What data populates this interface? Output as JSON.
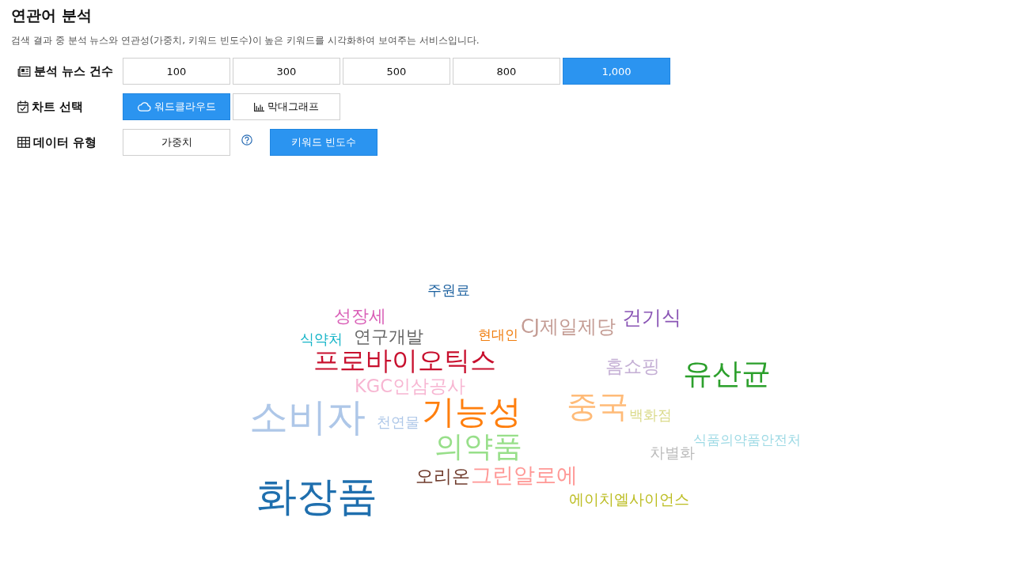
{
  "title": "연관어 분석",
  "description": "검색 결과 중 분석 뉴스와 연관성(가중치, 키워드 빈도수)이 높은 키워드를 시각화하여 보여주는 서비스입니다.",
  "options": [
    {
      "label": "분석 뉴스 건수",
      "choices": [
        {
          "label": "100",
          "selected": false,
          "help": false
        },
        {
          "label": "300",
          "selected": false,
          "help": false
        },
        {
          "label": "500",
          "selected": false,
          "help": false
        },
        {
          "label": "800",
          "selected": false,
          "help": false
        },
        {
          "label": "1,000",
          "selected": true,
          "help": false
        }
      ]
    },
    {
      "label": "차트 선택",
      "choices": [
        {
          "label": "워드클라우드",
          "selected": true,
          "help": false
        },
        {
          "label": "막대그래프",
          "selected": false,
          "help": false
        }
      ]
    },
    {
      "label": "데이터 유형",
      "choices": [
        {
          "label": "가중치",
          "selected": false,
          "help": true
        },
        {
          "label": "키워드 빈도수",
          "selected": true,
          "help": false
        }
      ]
    }
  ],
  "word_cloud": {
    "words": [
      {
        "text": "주원료",
        "color": "#1a5f9e"
      },
      {
        "text": "성장세",
        "color": "#d95fb7"
      },
      {
        "text": "식약처",
        "color": "#17b5c8"
      },
      {
        "text": "연구개발",
        "color": "#666666"
      },
      {
        "text": "현대인",
        "color": "#f07d0e"
      },
      {
        "text": "CJ제일제당",
        "color": "#c49c94"
      },
      {
        "text": "건기식",
        "color": "#8a55b5"
      },
      {
        "text": "프로바이오틱스",
        "color": "#c8102e"
      },
      {
        "text": "홈쇼핑",
        "color": "#c5b0d5"
      },
      {
        "text": "KGC인삼공사",
        "color": "#f7b6d2"
      },
      {
        "text": "유산균",
        "color": "#2ca02c"
      },
      {
        "text": "소비자",
        "color": "#aec7e8"
      },
      {
        "text": "천연물",
        "color": "#aec7e8"
      },
      {
        "text": "기능성",
        "color": "#ff7f0e"
      },
      {
        "text": "중국",
        "color": "#ffbb78"
      },
      {
        "text": "백화점",
        "color": "#dbdb8d"
      },
      {
        "text": "의약품",
        "color": "#98df8a"
      },
      {
        "text": "차별화",
        "color": "#bdbdbd"
      },
      {
        "text": "식품의약품안전처",
        "color": "#9edae5"
      },
      {
        "text": "오리온",
        "color": "#6f3b2c"
      },
      {
        "text": "그린알로에",
        "color": "#ff9896"
      },
      {
        "text": "화장품",
        "color": "#1f6fae"
      },
      {
        "text": "에이치엘사이언스",
        "color": "#bcbd22"
      }
    ]
  }
}
